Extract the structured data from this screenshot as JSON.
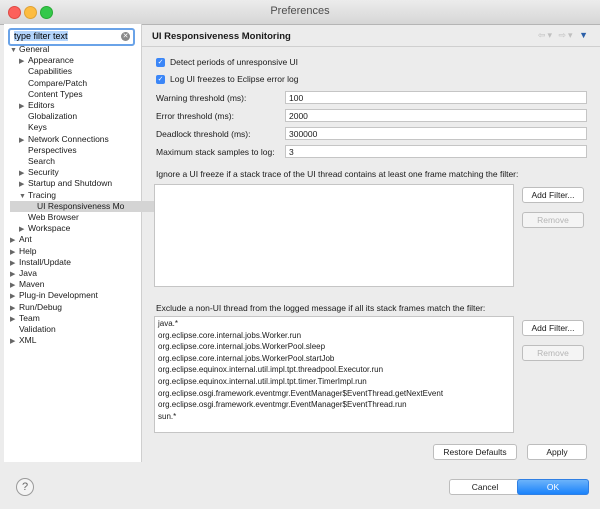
{
  "window": {
    "title": "Preferences"
  },
  "filter": {
    "placeholder": "type filter text"
  },
  "tree": [
    {
      "label": "General",
      "arrow": "▼",
      "indent": 0
    },
    {
      "label": "Appearance",
      "arrow": "▶",
      "indent": 1
    },
    {
      "label": "Capabilities",
      "arrow": "",
      "indent": 1
    },
    {
      "label": "Compare/Patch",
      "arrow": "",
      "indent": 1
    },
    {
      "label": "Content Types",
      "arrow": "",
      "indent": 1
    },
    {
      "label": "Editors",
      "arrow": "▶",
      "indent": 1
    },
    {
      "label": "Globalization",
      "arrow": "",
      "indent": 1
    },
    {
      "label": "Keys",
      "arrow": "",
      "indent": 1
    },
    {
      "label": "Network Connections",
      "arrow": "▶",
      "indent": 1
    },
    {
      "label": "Perspectives",
      "arrow": "",
      "indent": 1
    },
    {
      "label": "Search",
      "arrow": "",
      "indent": 1
    },
    {
      "label": "Security",
      "arrow": "▶",
      "indent": 1
    },
    {
      "label": "Startup and Shutdown",
      "arrow": "▶",
      "indent": 1
    },
    {
      "label": "Tracing",
      "arrow": "▼",
      "indent": 1
    },
    {
      "label": "UI Responsiveness Mo",
      "arrow": "",
      "indent": 2
    },
    {
      "label": "Web Browser",
      "arrow": "",
      "indent": 1
    },
    {
      "label": "Workspace",
      "arrow": "▶",
      "indent": 1
    },
    {
      "label": "Ant",
      "arrow": "▶",
      "indent": 0
    },
    {
      "label": "Help",
      "arrow": "▶",
      "indent": 0
    },
    {
      "label": "Install/Update",
      "arrow": "▶",
      "indent": 0
    },
    {
      "label": "Java",
      "arrow": "▶",
      "indent": 0
    },
    {
      "label": "Maven",
      "arrow": "▶",
      "indent": 0
    },
    {
      "label": "Plug-in Development",
      "arrow": "▶",
      "indent": 0
    },
    {
      "label": "Run/Debug",
      "arrow": "▶",
      "indent": 0
    },
    {
      "label": "Team",
      "arrow": "▶",
      "indent": 0
    },
    {
      "label": "Validation",
      "arrow": "",
      "indent": 0
    },
    {
      "label": "XML",
      "arrow": "▶",
      "indent": 0
    }
  ],
  "page": {
    "title": "UI Responsiveness Monitoring",
    "detect_label": "Detect periods of unresponsive UI",
    "log_label": "Log UI freezes to Eclipse error log",
    "fields": [
      {
        "label": "Warning threshold (ms):",
        "value": "100"
      },
      {
        "label": "Error threshold (ms):",
        "value": "2000"
      },
      {
        "label": "Deadlock threshold (ms):",
        "value": "300000"
      },
      {
        "label": "Maximum stack samples to log:",
        "value": "3"
      }
    ],
    "ignore_label": "Ignore a UI freeze if a stack trace of the UI thread contains at least one frame matching the filter:",
    "exclude_label": "Exclude a non-UI thread from the logged message if all its stack frames match the filter:",
    "exclude_items": [
      "java.*",
      "org.eclipse.core.internal.jobs.Worker.run",
      "org.eclipse.core.internal.jobs.WorkerPool.sleep",
      "org.eclipse.core.internal.jobs.WorkerPool.startJob",
      "org.eclipse.equinox.internal.util.impl.tpt.threadpool.Executor.run",
      "org.eclipse.equinox.internal.util.impl.tpt.timer.TimerImpl.run",
      "org.eclipse.osgi.framework.eventmgr.EventManager$EventThread.getNextEvent",
      "org.eclipse.osgi.framework.eventmgr.EventManager$EventThread.run",
      "sun.*"
    ],
    "add_filter": "Add Filter...",
    "remove": "Remove",
    "restore_defaults": "Restore Defaults",
    "apply": "Apply"
  },
  "footer": {
    "cancel": "Cancel",
    "ok": "OK"
  }
}
